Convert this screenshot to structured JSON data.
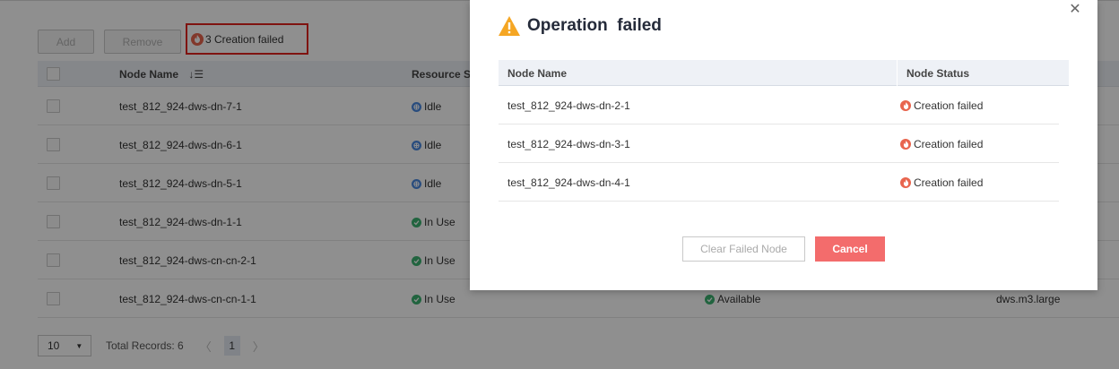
{
  "toolbar": {
    "add_label": "Add",
    "remove_label": "Remove",
    "fail_text": "3 Creation failed"
  },
  "table": {
    "headers": {
      "name": "Node Name",
      "resource": "Resource St"
    },
    "rows": [
      {
        "name": "test_812_924-dws-dn-7-1",
        "resource": "Idle",
        "resource_type": "idle"
      },
      {
        "name": "test_812_924-dws-dn-6-1",
        "resource": "Idle",
        "resource_type": "idle"
      },
      {
        "name": "test_812_924-dws-dn-5-1",
        "resource": "Idle",
        "resource_type": "idle"
      },
      {
        "name": "test_812_924-dws-dn-1-1",
        "resource": "In Use",
        "resource_type": "inuse"
      },
      {
        "name": "test_812_924-dws-cn-cn-2-1",
        "resource": "In Use",
        "resource_type": "inuse"
      },
      {
        "name": "test_812_924-dws-cn-cn-1-1",
        "resource": "In Use",
        "resource_type": "inuse",
        "status": "Available",
        "spec": "dws.m3.large"
      }
    ]
  },
  "pager": {
    "page_size": "10",
    "total": "Total Records: 6",
    "current_page": "1"
  },
  "dialog": {
    "title": "Operation  failed",
    "col_name": "Node Name",
    "col_status": "Node Status",
    "rows": [
      {
        "name": "test_812_924-dws-dn-2-1",
        "status": "Creation failed"
      },
      {
        "name": "test_812_924-dws-dn-3-1",
        "status": "Creation failed"
      },
      {
        "name": "test_812_924-dws-dn-4-1",
        "status": "Creation failed"
      }
    ],
    "clear_label": "Clear Failed Node",
    "cancel_label": "Cancel"
  },
  "colors": {
    "accent_danger": "#f36c6c",
    "fail_icon": "#e8654e",
    "warning": "#f5a623",
    "idle": "#4b8ae0",
    "in_use": "#3cb371"
  }
}
